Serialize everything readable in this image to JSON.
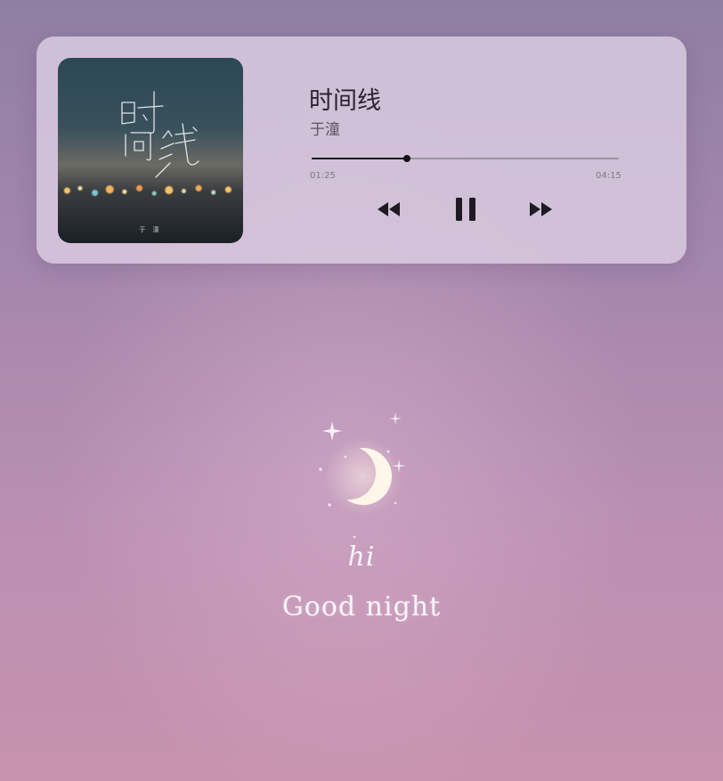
{
  "player": {
    "song_title": "时间线",
    "artist": "于潼",
    "current_time": "01:25",
    "total_time": "04:15",
    "progress": 0.31,
    "cover": {
      "title_text": "时间线",
      "artist_text": "于 潼"
    },
    "controls": {
      "prev_icon": "rewind-icon",
      "pause_icon": "pause-icon",
      "next_icon": "fast-forward-icon"
    }
  },
  "wallpaper": {
    "greeting_line1": "hi",
    "greeting_line2": "Good night",
    "icon": "crescent-moon-icon"
  },
  "colors": {
    "card_bg": "#dacee2",
    "progress_fill": "#151217",
    "progress_track": "#9a939f",
    "text_primary": "#2b2330"
  }
}
